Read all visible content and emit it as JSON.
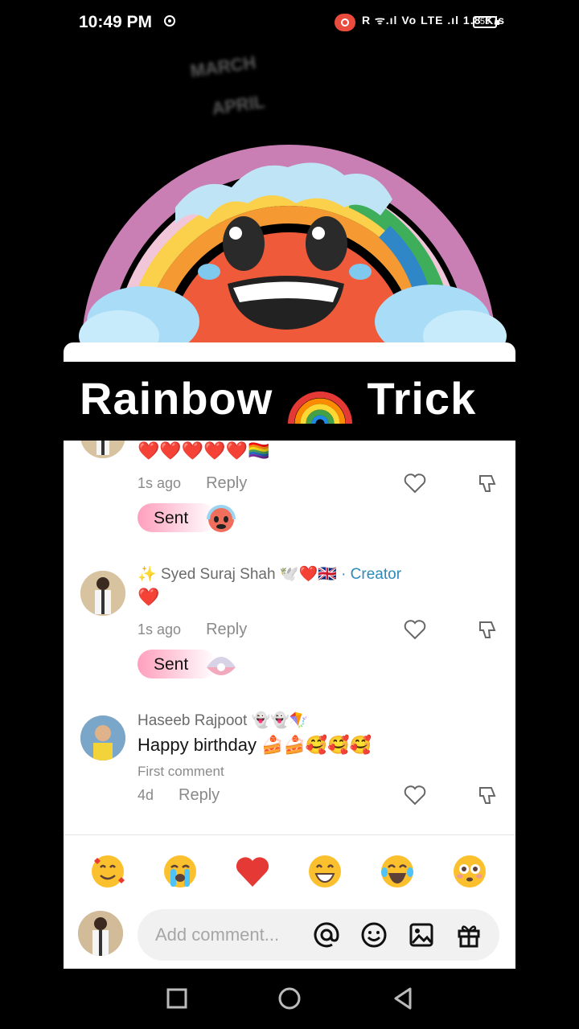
{
  "status_bar": {
    "time": "10:49 PM",
    "net_icons": "R ᯤ.ıl Vo LTE .ıl 1.8 K/s",
    "battery": "55"
  },
  "video": {
    "faded_line_1": "MARCH",
    "faded_line_2": "APRIL",
    "title_left": "Rainbow",
    "title_right": "Trick"
  },
  "comments": [
    {
      "username": "",
      "text": "❤️❤️❤️❤️❤️🏳️‍🌈",
      "time": "1s ago",
      "reply": "Reply",
      "status": "Sent"
    },
    {
      "username_prefix": "✨",
      "username": "Syed Suraj Shah 🕊️❤️🇬🇧",
      "badge": "· Creator",
      "text": "❤️",
      "time": "1s ago",
      "reply": "Reply",
      "status": "Sent"
    },
    {
      "username": "Haseeb Rajpoot 👻👻🪁",
      "text": "Happy birthday 🍰🍰🥰🥰🥰",
      "label": "First comment",
      "time": "4d",
      "reply": "Reply"
    }
  ],
  "quick_emojis": [
    "smiling-face-with-hearts",
    "loudly-crying-face",
    "red-heart",
    "beaming-face",
    "face-with-tears-of-joy",
    "flushed-face"
  ],
  "input": {
    "placeholder": "Add comment..."
  },
  "colors": {
    "accent_creator": "#2e8ab8",
    "sent_pill": "#ff9fbd"
  }
}
